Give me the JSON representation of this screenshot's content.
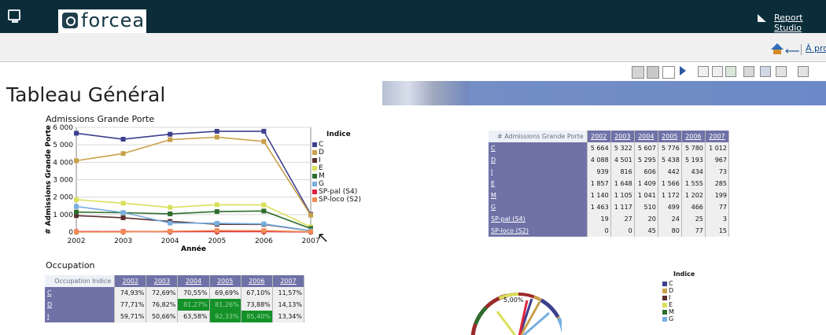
{
  "app": {
    "brand": "forcea",
    "report_studio": "Report Studio",
    "about_link": "À propos d"
  },
  "page": {
    "title": "Tableau Général"
  },
  "chart_data": [
    {
      "type": "line",
      "title": "Admissions Grande Porte",
      "xlabel": "Année",
      "ylabel": "# Admissions Grande Porte",
      "legend_title": "Indice",
      "x": [
        "2002",
        "2003",
        "2004",
        "2005",
        "2006",
        "2007"
      ],
      "ylim": [
        0,
        6000
      ],
      "yticks": [
        "0",
        "1 000",
        "2 000",
        "3 000",
        "4 000",
        "5 000",
        "6 000"
      ],
      "series": [
        {
          "name": "C",
          "color": "#3d3f8e",
          "values": [
            5664,
            5322,
            5607,
            5776,
            5780,
            1012
          ]
        },
        {
          "name": "D",
          "color": "#c9a04b",
          "values": [
            4088,
            4501,
            5295,
            5438,
            5193,
            967
          ]
        },
        {
          "name": "I",
          "color": "#5a3030",
          "values": [
            939,
            816,
            606,
            442,
            434,
            73
          ]
        },
        {
          "name": "E",
          "color": "#d9e05a",
          "values": [
            1857,
            1648,
            1409,
            1566,
            1555,
            285
          ]
        },
        {
          "name": "M",
          "color": "#2e6d2f",
          "values": [
            1140,
            1105,
            1041,
            1172,
            1202,
            199
          ]
        },
        {
          "name": "G",
          "color": "#78aee0",
          "values": [
            1463,
            1117,
            510,
            499,
            466,
            77
          ]
        },
        {
          "name": "SP-pal (S4)",
          "color": "#e0243f",
          "values": [
            19,
            27,
            20,
            24,
            25,
            3
          ]
        },
        {
          "name": "SP-loco (S2)",
          "color": "#f08d55",
          "values": [
            0,
            0,
            45,
            80,
            77,
            15
          ]
        }
      ]
    },
    {
      "type": "table",
      "title": "# Admissions Grande Porte",
      "columns": [
        "2002",
        "2003",
        "2004",
        "2005",
        "2006",
        "2007"
      ],
      "rows": [
        {
          "label": "C",
          "values": [
            "5 664",
            "5 322",
            "5 607",
            "5 776",
            "5 780",
            "1 012"
          ]
        },
        {
          "label": "D",
          "values": [
            "4 088",
            "4 501",
            "5 295",
            "5 438",
            "5 193",
            "967"
          ]
        },
        {
          "label": "I",
          "values": [
            "939",
            "816",
            "606",
            "442",
            "434",
            "73"
          ]
        },
        {
          "label": "E",
          "values": [
            "1 857",
            "1 648",
            "1 409",
            "1 566",
            "1 555",
            "285"
          ]
        },
        {
          "label": "M",
          "values": [
            "1 140",
            "1 105",
            "1 041",
            "1 172",
            "1 202",
            "199"
          ]
        },
        {
          "label": "G",
          "values": [
            "1 463",
            "1 117",
            "510",
            "499",
            "466",
            "77"
          ]
        },
        {
          "label": "SP-pal (S4)",
          "values": [
            "19",
            "27",
            "20",
            "24",
            "25",
            "3"
          ]
        },
        {
          "label": "SP-loco (S2)",
          "values": [
            "0",
            "0",
            "45",
            "80",
            "77",
            "15"
          ]
        }
      ]
    },
    {
      "type": "table",
      "title": "Occupation",
      "header_label": "Occupation Indice",
      "columns": [
        "2002",
        "2003",
        "2004",
        "2005",
        "2006",
        "2007"
      ],
      "rows": [
        {
          "label": "C",
          "values": [
            "74,93%",
            "72,69%",
            "70,55%",
            "69,69%",
            "67,10%",
            "11,57%"
          ],
          "highlight": []
        },
        {
          "label": "D",
          "values": [
            "77,71%",
            "76,82%",
            "81,27%",
            "81,26%",
            "73,88%",
            "14,13%"
          ],
          "highlight": [
            2,
            3
          ]
        },
        {
          "label": "I",
          "values": [
            "59,71%",
            "50,66%",
            "63,58%",
            "92,33%",
            "85,40%",
            "13,34%"
          ],
          "highlight": [
            3,
            4
          ]
        }
      ]
    },
    {
      "type": "pie",
      "title": "",
      "label": "5,00%",
      "legend_title": "Indice",
      "legend": [
        {
          "name": "C",
          "color": "#3d3f8e"
        },
        {
          "name": "D",
          "color": "#c9a04b"
        },
        {
          "name": "I",
          "color": "#5a3030"
        },
        {
          "name": "E",
          "color": "#d9e05a"
        },
        {
          "name": "M",
          "color": "#2e6d2f"
        },
        {
          "name": "G",
          "color": "#78aee0"
        }
      ]
    }
  ],
  "colors": {
    "top_bar": "#0b2d3a",
    "header_purple": "#6f72a7",
    "highlight_green": "#149128",
    "banner_blue": "#6c89c7"
  },
  "icons": {
    "window": "window-icon",
    "report_studio": "report-studio-icon",
    "home": "home-icon",
    "back": "back-arrow-icon"
  }
}
